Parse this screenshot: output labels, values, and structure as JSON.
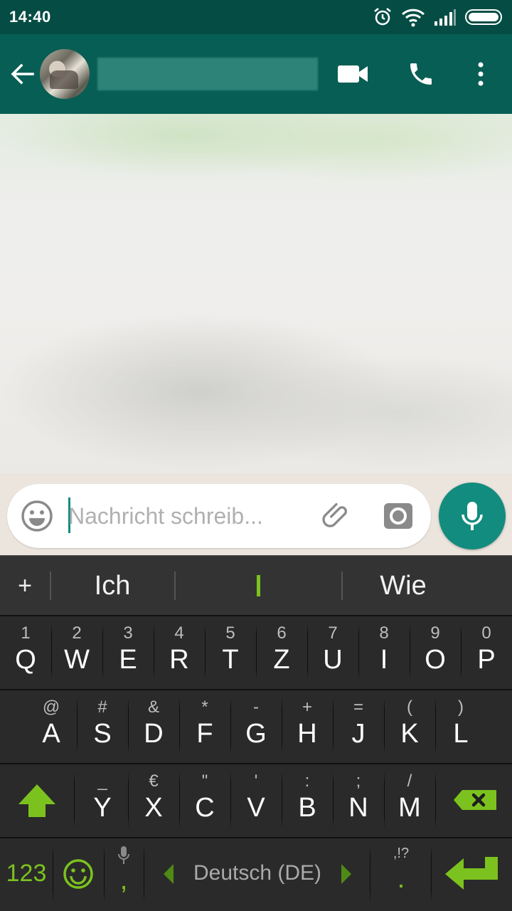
{
  "status_bar": {
    "time": "14:40"
  },
  "header": {
    "contact_name": ""
  },
  "composer": {
    "placeholder": "Nachricht schreib..."
  },
  "keyboard": {
    "suggestions": [
      "Ich",
      "",
      "Wie"
    ],
    "row1": [
      {
        "hint": "1",
        "key": "Q"
      },
      {
        "hint": "2",
        "key": "W"
      },
      {
        "hint": "3",
        "key": "E"
      },
      {
        "hint": "4",
        "key": "R"
      },
      {
        "hint": "5",
        "key": "T"
      },
      {
        "hint": "6",
        "key": "Z"
      },
      {
        "hint": "7",
        "key": "U"
      },
      {
        "hint": "8",
        "key": "I"
      },
      {
        "hint": "9",
        "key": "O"
      },
      {
        "hint": "0",
        "key": "P"
      }
    ],
    "row2": [
      {
        "hint": "@",
        "key": "A"
      },
      {
        "hint": "#",
        "key": "S"
      },
      {
        "hint": "&",
        "key": "D"
      },
      {
        "hint": "*",
        "key": "F"
      },
      {
        "hint": "-",
        "key": "G"
      },
      {
        "hint": "+",
        "key": "H"
      },
      {
        "hint": "=",
        "key": "J"
      },
      {
        "hint": "(",
        "key": "K"
      },
      {
        "hint": ")",
        "key": "L"
      }
    ],
    "row3": [
      {
        "hint": "_",
        "key": "Y"
      },
      {
        "hint": "€",
        "key": "X"
      },
      {
        "hint": "\"",
        "key": "C"
      },
      {
        "hint": "'",
        "key": "V"
      },
      {
        "hint": ":",
        "key": "B"
      },
      {
        "hint": ";",
        "key": "N"
      },
      {
        "hint": "/",
        "key": "M"
      }
    ],
    "numbers_label": "123",
    "comma_label": ",",
    "language_label": "Deutsch (DE)",
    "period_hint": ",!?",
    "period_label": "."
  },
  "colors": {
    "status_bar": "#054d44",
    "app_bar": "#075e54",
    "accent": "#128c7e",
    "keyboard_green": "#7cc21e"
  },
  "icons": [
    "alarm-icon",
    "wifi-icon",
    "signal-icon",
    "battery-icon",
    "back-arrow-icon",
    "video-call-icon",
    "phone-icon",
    "more-vert-icon",
    "emoji-icon",
    "attach-icon",
    "camera-icon",
    "mic-icon",
    "shift-icon",
    "backspace-icon",
    "smiley-key-icon",
    "enter-icon"
  ]
}
